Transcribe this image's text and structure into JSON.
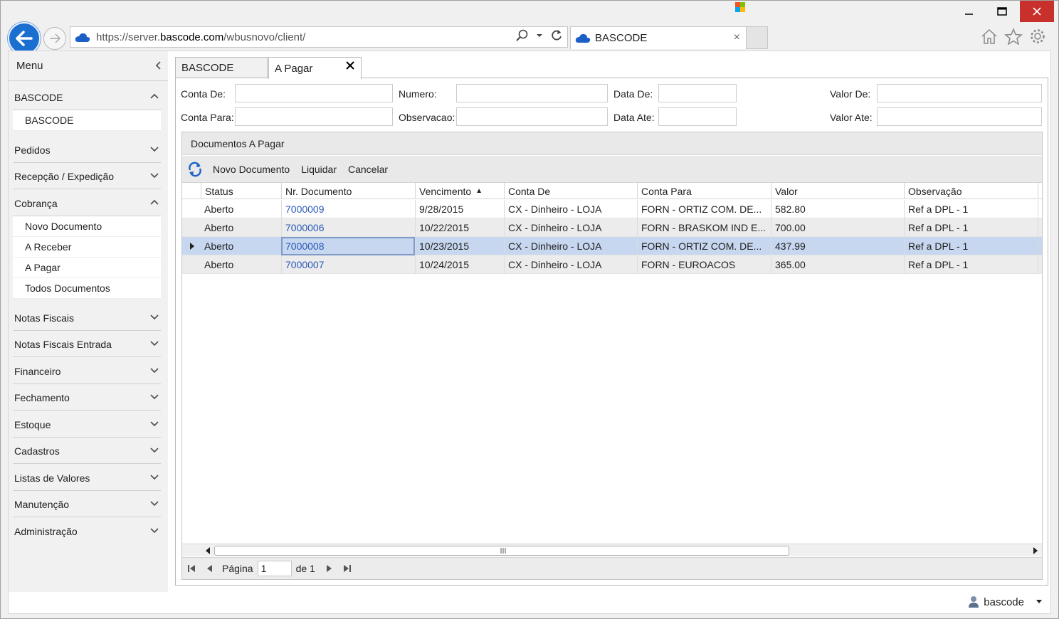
{
  "browser": {
    "url_prefix": "https://server.",
    "url_domain": "bascode.com",
    "url_path": "/wbusnovo/client/",
    "tab_title": "BASCODE",
    "close_glyph": "×"
  },
  "sidebar": {
    "title": "Menu",
    "sections": [
      {
        "label": "BASCODE",
        "expanded": true
      },
      {
        "label": "Pedidos",
        "expanded": false
      },
      {
        "label": "Recepção / Expedição",
        "expanded": false
      },
      {
        "label": "Cobrança",
        "expanded": true
      },
      {
        "label": "Notas Fiscais",
        "expanded": false
      },
      {
        "label": "Notas Fiscais Entrada",
        "expanded": false
      },
      {
        "label": "Financeiro",
        "expanded": false
      },
      {
        "label": "Fechamento",
        "expanded": false
      },
      {
        "label": "Estoque",
        "expanded": false
      },
      {
        "label": "Cadastros",
        "expanded": false
      },
      {
        "label": "Listas de Valores",
        "expanded": false
      },
      {
        "label": "Manutenção",
        "expanded": false
      },
      {
        "label": "Administração",
        "expanded": false
      }
    ],
    "bascode_items": [
      "BASCODE"
    ],
    "cobranca_items": [
      "Novo Documento",
      "A Receber",
      "A Pagar",
      "Todos Documentos"
    ]
  },
  "tabs": [
    {
      "label": "BASCODE"
    },
    {
      "label": "A Pagar"
    }
  ],
  "filters": {
    "conta_de": "Conta De:",
    "conta_para": "Conta Para:",
    "numero": "Numero:",
    "observacao": "Observacao:",
    "data_de": "Data De:",
    "data_ate": "Data Ate:",
    "valor_de": "Valor De:",
    "valor_ate": "Valor Ate:"
  },
  "grid": {
    "title": "Documentos A Pagar",
    "toolbar": [
      "Novo Documento",
      "Liquidar",
      "Cancelar"
    ],
    "columns": [
      "Status",
      "Nr. Documento",
      "Vencimento",
      "Conta De",
      "Conta Para",
      "Valor",
      "Observação"
    ],
    "sort_indicator": "▲",
    "rows": [
      {
        "status": "Aberto",
        "nr": "7000009",
        "venc": "9/28/2015",
        "de": "CX - Dinheiro - LOJA",
        "para": "FORN - ORTIZ COM. DE...",
        "valor": "582.80",
        "obs": "Ref a DPL - 1"
      },
      {
        "status": "Aberto",
        "nr": "7000006",
        "venc": "10/22/2015",
        "de": "CX - Dinheiro - LOJA",
        "para": "FORN - BRASKOM IND E...",
        "valor": "700.00",
        "obs": "Ref a DPL - 1"
      },
      {
        "status": "Aberto",
        "nr": "7000008",
        "venc": "10/23/2015",
        "de": "CX - Dinheiro - LOJA",
        "para": "FORN - ORTIZ COM. DE...",
        "valor": "437.99",
        "obs": "Ref a DPL - 1"
      },
      {
        "status": "Aberto",
        "nr": "7000007",
        "venc": "10/24/2015",
        "de": "CX - Dinheiro - LOJA",
        "para": "FORN - EUROACOS",
        "valor": "365.00",
        "obs": "Ref a DPL - 1"
      }
    ]
  },
  "pager": {
    "page_label": "Página",
    "page_value": "1",
    "of_label": "de 1"
  },
  "status": {
    "user": "bascode"
  }
}
